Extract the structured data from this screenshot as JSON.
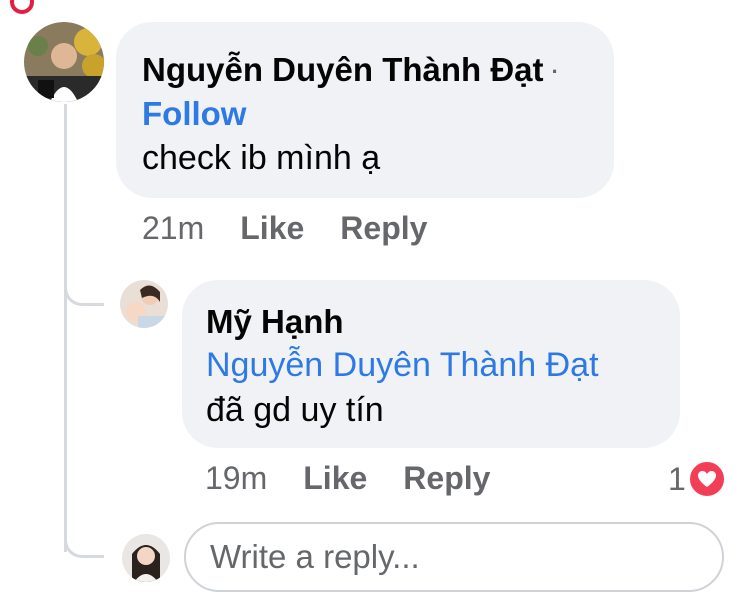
{
  "comments": [
    {
      "author": "Nguyễn Duyên Thành Đạt",
      "separator": "·",
      "follow_label": "Follow",
      "text": "check ib mình ạ",
      "time": "21m",
      "like_label": "Like",
      "reply_label": "Reply"
    },
    {
      "author": "Mỹ Hạnh",
      "mention": "Nguyễn Duyên Thành Đạt",
      "text": "đã gd uy tín",
      "time": "19m",
      "like_label": "Like",
      "reply_label": "Reply",
      "reaction_count": "1",
      "reaction_icon": "heart-icon"
    }
  ],
  "reply_box": {
    "placeholder": "Write a reply..."
  },
  "colors": {
    "bubble": "#f0f2f5",
    "link": "#2d7ae5",
    "meta": "#65676b",
    "heart": "#f33e58",
    "notification_ring": "#e41e3f"
  }
}
